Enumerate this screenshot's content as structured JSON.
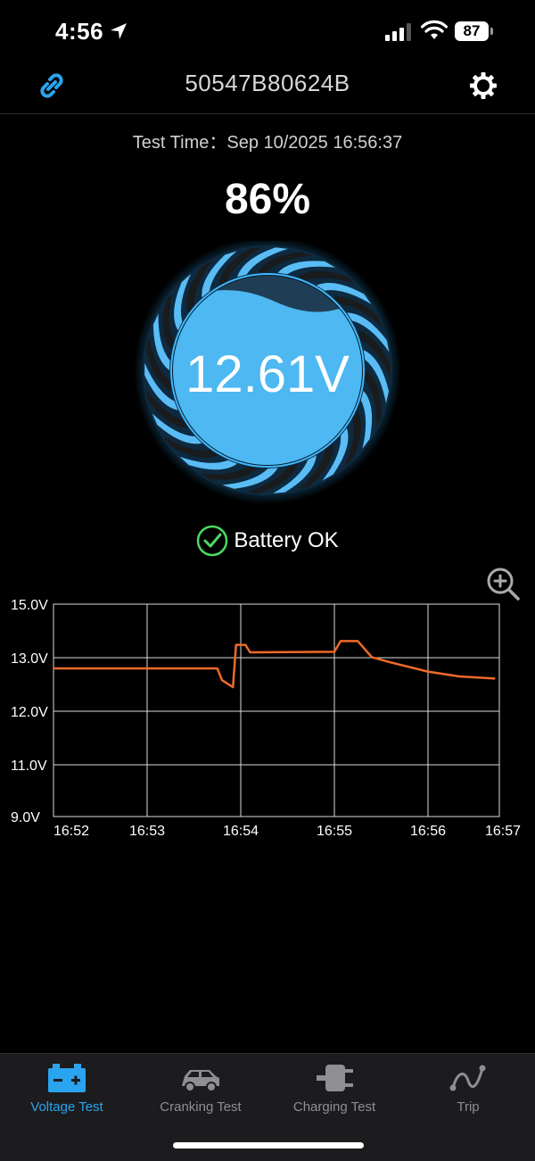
{
  "status_bar": {
    "time": "4:56",
    "battery": "87"
  },
  "header": {
    "device_id": "50547B80624B"
  },
  "test_time": "Test Time：Sep 10/2025 16:56:37",
  "gauge": {
    "percent": "86%",
    "voltage": "12.61V",
    "charge_level": 0.86
  },
  "status": {
    "text": "Battery OK",
    "color": "#4cd964"
  },
  "chart_data": {
    "type": "line",
    "x_ticks": [
      "16:52",
      "16:53",
      "16:54",
      "16:55",
      "16:56",
      "16:57"
    ],
    "y_ticks": [
      "15.0V",
      "13.0V",
      "12.0V",
      "11.0V",
      "9.0V"
    ],
    "series": [
      {
        "color": "#f06a28",
        "points": [
          [
            "16:52:00",
            12.8
          ],
          [
            "16:53:00",
            12.8
          ],
          [
            "16:53:45",
            12.8
          ],
          [
            "16:53:48",
            12.58
          ],
          [
            "16:53:55",
            12.45
          ],
          [
            "16:53:57",
            13.48
          ],
          [
            "16:54:03",
            13.48
          ],
          [
            "16:54:06",
            13.2
          ],
          [
            "16:55:00",
            13.22
          ],
          [
            "16:55:04",
            13.62
          ],
          [
            "16:55:15",
            13.62
          ],
          [
            "16:55:24",
            13.02
          ],
          [
            "16:55:35",
            12.92
          ],
          [
            "16:56:00",
            12.74
          ],
          [
            "16:56:20",
            12.65
          ],
          [
            "16:56:43",
            12.61
          ]
        ]
      }
    ],
    "grid": true
  },
  "tabs": [
    {
      "label": "Voltage Test",
      "active": true
    },
    {
      "label": "Cranking Test",
      "active": false
    },
    {
      "label": "Charging Test",
      "active": false
    },
    {
      "label": "Trip",
      "active": false
    }
  ],
  "colors": {
    "accent": "#2aa4ee",
    "line": "#f06a28",
    "ok": "#4cd964"
  }
}
